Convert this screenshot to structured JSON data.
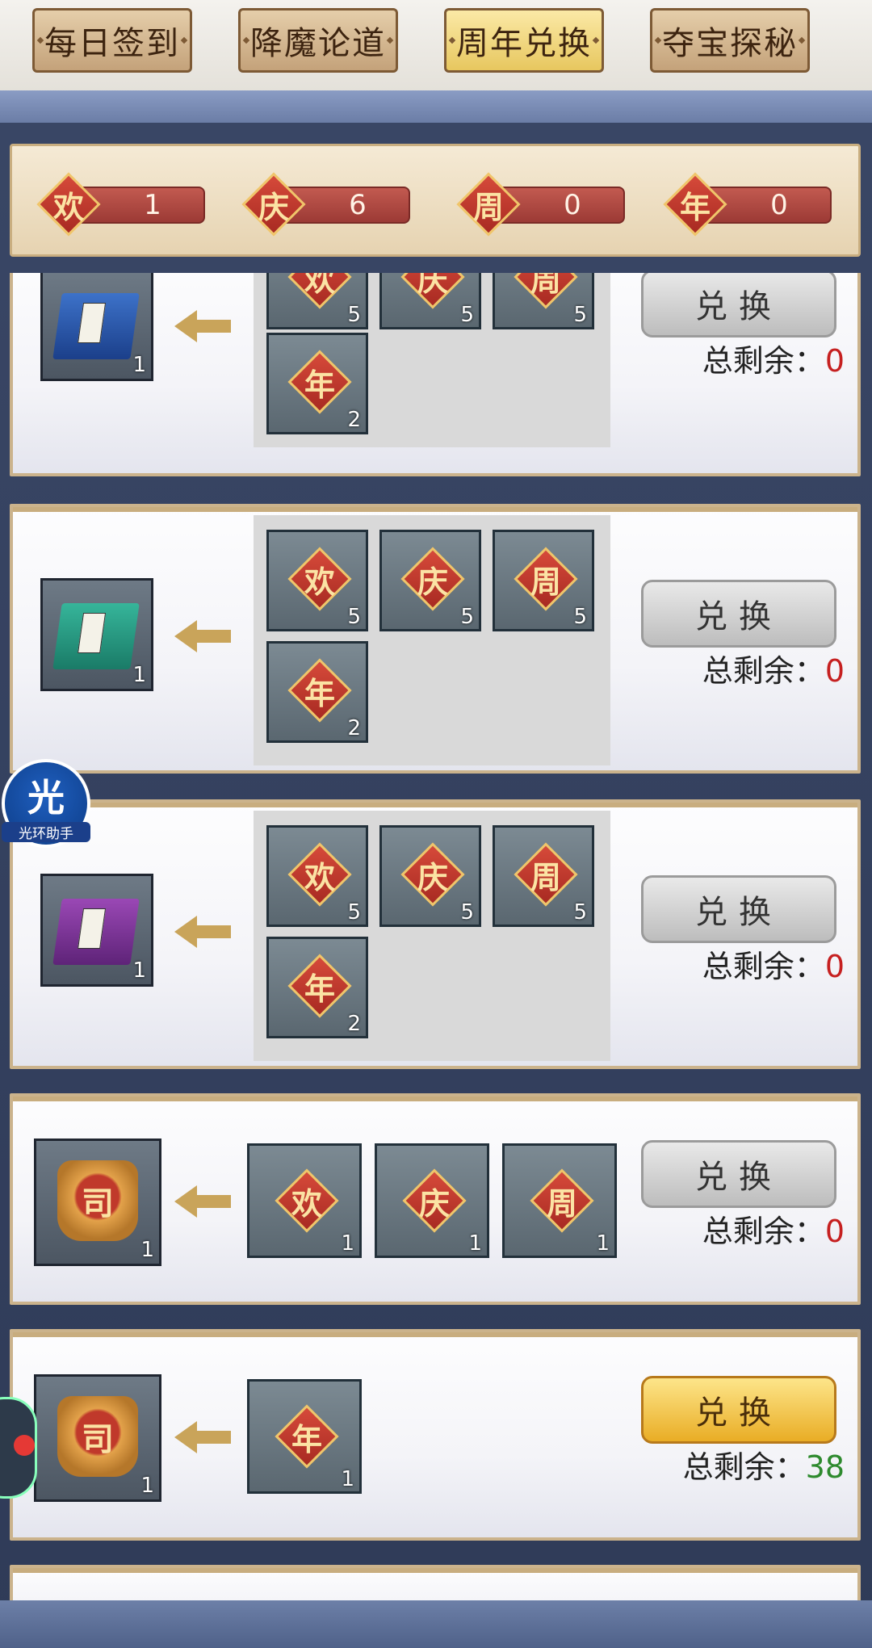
{
  "tabs": [
    {
      "label": "每日签到",
      "active": false
    },
    {
      "label": "降魔论道",
      "active": false
    },
    {
      "label": "周年兑换",
      "active": true
    },
    {
      "label": "夺宝探秘",
      "active": false
    }
  ],
  "tokens": [
    {
      "char": "欢",
      "count": "1"
    },
    {
      "char": "庆",
      "count": "6"
    },
    {
      "char": "周",
      "count": "0"
    },
    {
      "char": "年",
      "count": "0"
    }
  ],
  "exchanges": [
    {
      "reward_icon": "blue-skill-book-icon",
      "reward_count": "1",
      "costs": [
        {
          "char": "欢",
          "count": "5"
        },
        {
          "char": "庆",
          "count": "5"
        },
        {
          "char": "周",
          "count": "5"
        },
        {
          "char": "年",
          "count": "2"
        }
      ],
      "button": "兑换",
      "remain_label": "总剩余：",
      "remain_value": "0",
      "enabled": false
    },
    {
      "reward_icon": "green-skill-book-icon",
      "reward_count": "1",
      "costs": [
        {
          "char": "欢",
          "count": "5"
        },
        {
          "char": "庆",
          "count": "5"
        },
        {
          "char": "周",
          "count": "5"
        },
        {
          "char": "年",
          "count": "2"
        }
      ],
      "button": "兑换",
      "remain_label": "总剩余：",
      "remain_value": "0",
      "enabled": false
    },
    {
      "reward_icon": "purple-skill-book-icon",
      "reward_count": "1",
      "costs": [
        {
          "char": "欢",
          "count": "5"
        },
        {
          "char": "庆",
          "count": "5"
        },
        {
          "char": "周",
          "count": "5"
        },
        {
          "char": "年",
          "count": "2"
        }
      ],
      "button": "兑换",
      "remain_label": "总剩余：",
      "remain_value": "0",
      "enabled": false
    },
    {
      "reward_icon": "red-emblem-icon",
      "reward_count": "1",
      "costs": [
        {
          "char": "欢",
          "count": "1"
        },
        {
          "char": "庆",
          "count": "1"
        },
        {
          "char": "周",
          "count": "1"
        }
      ],
      "button": "兑换",
      "remain_label": "总剩余：",
      "remain_value": "0",
      "enabled": false
    },
    {
      "reward_icon": "red-emblem-icon",
      "reward_count": "1",
      "costs": [
        {
          "char": "年",
          "count": "1"
        }
      ],
      "button": "兑换",
      "remain_label": "总剩余：",
      "remain_value": "38",
      "enabled": true
    }
  ],
  "emblem_char": "司",
  "float_widget": {
    "glyph": "光",
    "label": "光环助手"
  },
  "colors": {
    "remain_zero": "#c62020",
    "remain_available": "#2e8a2e",
    "token_red": "#c0392b"
  }
}
